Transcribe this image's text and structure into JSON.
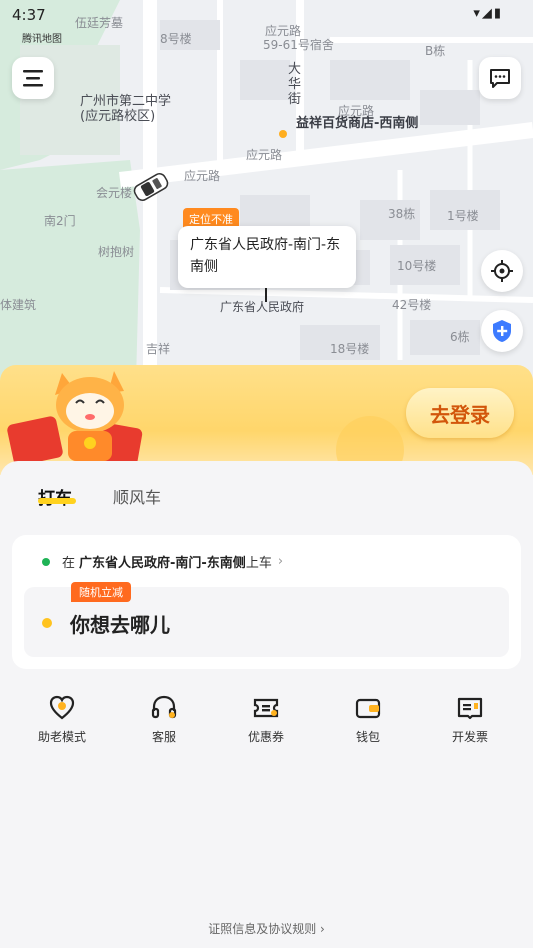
{
  "status_bar": {
    "time": "4:37",
    "icons": "▾◢▮"
  },
  "map": {
    "labels": {
      "wuting": "伍廷芳墓",
      "tencent": "腾讯地图",
      "no8": "8号楼",
      "yingyuanlu_top": "应元路",
      "dorm": "59-61号宿舍",
      "bdong": "B栋",
      "dahuajie": "大华街",
      "school": "广州市第二中学\n(应元路校区)",
      "yingyuanlu2": "应元路",
      "yingyuanlu_stop": "应元路",
      "shop": "益祥百货商店-西南侧",
      "yingyuanlu3": "应元路",
      "huiyuan": "会元楼",
      "south2": "南2门",
      "no38": "38栋",
      "no1": "1号楼",
      "shubao": "树抱树",
      "no10": "10号楼",
      "gov": "广东省人民政府",
      "no42": "42号楼",
      "building": "体建筑",
      "no6": "6栋",
      "no18": "18号楼",
      "jixiang": "吉祥"
    },
    "pickup_tag": "定位不准",
    "pickup_card": "广东省人民政府-南门-东南侧"
  },
  "banner": {
    "login_label": "去登录"
  },
  "tabs": [
    {
      "label": "打车",
      "active": true
    },
    {
      "label": "顺风车",
      "active": false
    }
  ],
  "booking": {
    "pickup_prefix": "在",
    "pickup_place": "广东省人民政府-南门-东南侧",
    "pickup_suffix": "上车",
    "promo": "随机立减",
    "destination_placeholder": "你想去哪儿"
  },
  "services": [
    {
      "label": "助老模式",
      "icon": "heart-icon"
    },
    {
      "label": "客服",
      "icon": "headset-icon"
    },
    {
      "label": "优惠券",
      "icon": "coupon-icon"
    },
    {
      "label": "钱包",
      "icon": "wallet-icon"
    },
    {
      "label": "开发票",
      "icon": "invoice-icon"
    }
  ],
  "footer": {
    "link": "证照信息及协议规则 ›"
  },
  "colors": {
    "accent": "#ffd21f",
    "promo": "#ff6a1f",
    "login_text": "#d2560b",
    "green_dot": "#1fb356"
  }
}
